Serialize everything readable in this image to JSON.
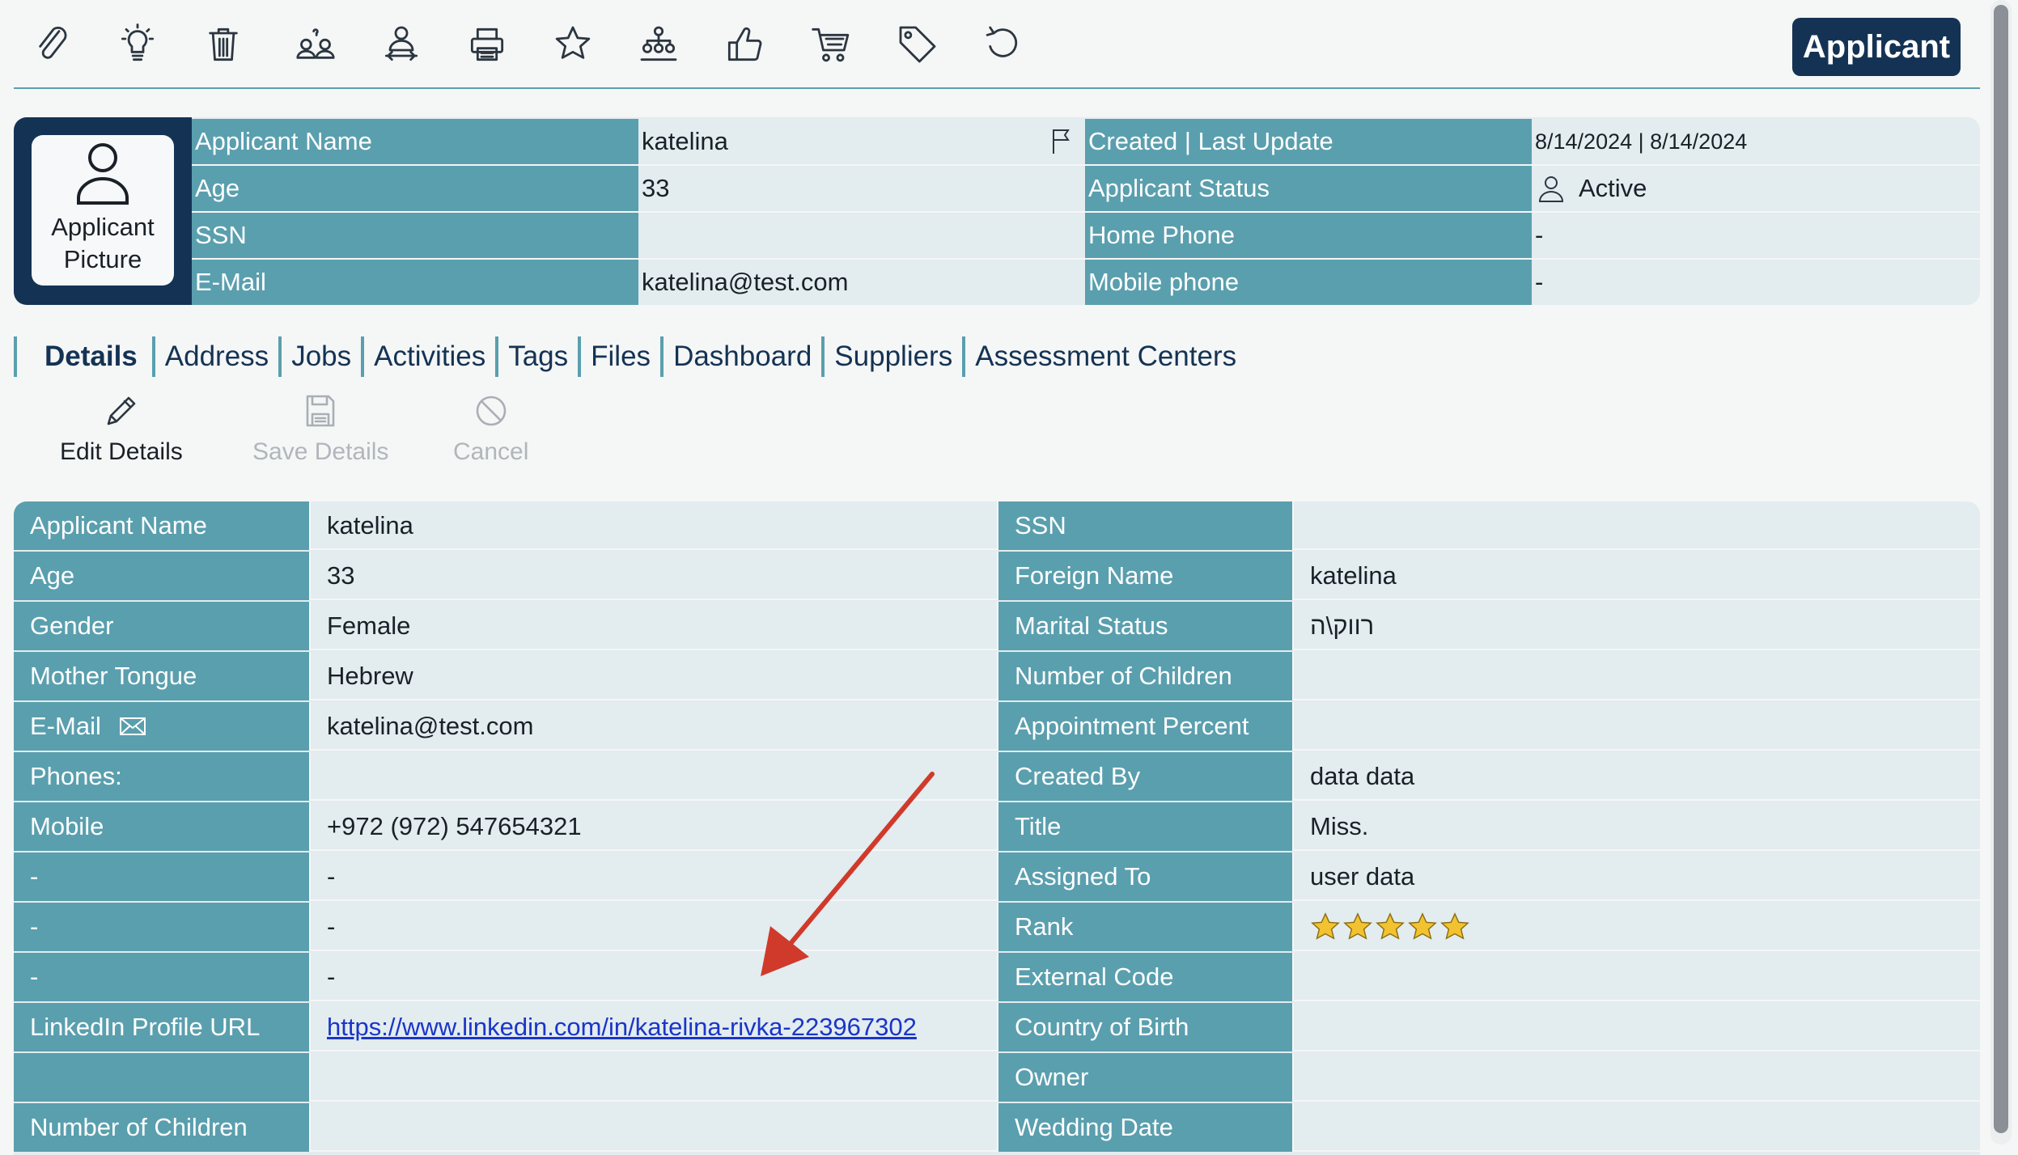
{
  "toolbar": {
    "icons": [
      "paperclip-icon",
      "lightbulb-icon",
      "trash-icon",
      "people-question-icon",
      "person-transfer-icon",
      "printer-icon",
      "star-icon",
      "hierarchy-icon",
      "thumbs-up-icon",
      "cart-icon",
      "tag-icon",
      "refresh-icon"
    ],
    "brand": "Applicant"
  },
  "header": {
    "picture_label": "Applicant Picture",
    "rows": [
      {
        "label": "Applicant Name",
        "value": "katelina",
        "right_label": "Created | Last Update",
        "right_value": "8/14/2024  |  8/14/2024"
      },
      {
        "label": "Age",
        "value": "33",
        "right_label": "Applicant Status",
        "right_value": "Active"
      },
      {
        "label": "SSN",
        "value": "",
        "right_label": "Home Phone",
        "right_value": "-"
      },
      {
        "label": "E-Mail",
        "value": "katelina@test.com",
        "right_label": "Mobile phone",
        "right_value": "-"
      }
    ]
  },
  "tabs": [
    "Details",
    "Address",
    "Jobs",
    "Activities",
    "Tags",
    "Files",
    "Dashboard",
    "Suppliers",
    "Assessment Centers"
  ],
  "actions": {
    "edit": "Edit Details",
    "save": "Save Details",
    "cancel": "Cancel"
  },
  "details": {
    "rows": [
      {
        "l_label": "Applicant Name",
        "l_value": "katelina",
        "r_label": "SSN",
        "r_value": ""
      },
      {
        "l_label": "Age",
        "l_value": "33",
        "r_label": "Foreign Name",
        "r_value": "katelina"
      },
      {
        "l_label": "Gender",
        "l_value": "Female",
        "r_label": "Marital Status",
        "r_value": "רווק\\ה"
      },
      {
        "l_label": "Mother Tongue",
        "l_value": "Hebrew",
        "r_label": "Number of Children",
        "r_value": ""
      },
      {
        "l_label": "E-Mail",
        "l_value": "katelina@test.com",
        "r_label": "Appointment Percent",
        "r_value": ""
      },
      {
        "l_label": "Phones:",
        "l_value": "",
        "r_label": "Created By",
        "r_value": "data data"
      },
      {
        "l_label": "Mobile",
        "l_value": "+972 (972) 547654321",
        "r_label": "Title",
        "r_value": "Miss."
      },
      {
        "l_label": "-",
        "l_value": "-",
        "r_label": "Assigned To",
        "r_value": "user data"
      },
      {
        "l_label": "-",
        "l_value": "-",
        "r_label": "Rank",
        "r_value": ""
      },
      {
        "l_label": "-",
        "l_value": "-",
        "r_label": "External Code",
        "r_value": ""
      },
      {
        "l_label": "LinkedIn Profile URL",
        "l_value": "https://www.linkedin.com/in/katelina-rivka-223967302",
        "r_label": "Country of Birth",
        "r_value": ""
      },
      {
        "l_label": "",
        "l_value": "",
        "r_label": "Owner",
        "r_value": ""
      },
      {
        "l_label": "Number of Children",
        "l_value": "",
        "r_label": "Wedding Date",
        "r_value": ""
      }
    ],
    "rank_stars": 5,
    "rank_max": 5
  },
  "colors": {
    "accent": "#5a9fae",
    "brand": "#143354",
    "link": "#1a35c8",
    "arrow": "#d03a2b",
    "star": "#f2c230"
  }
}
